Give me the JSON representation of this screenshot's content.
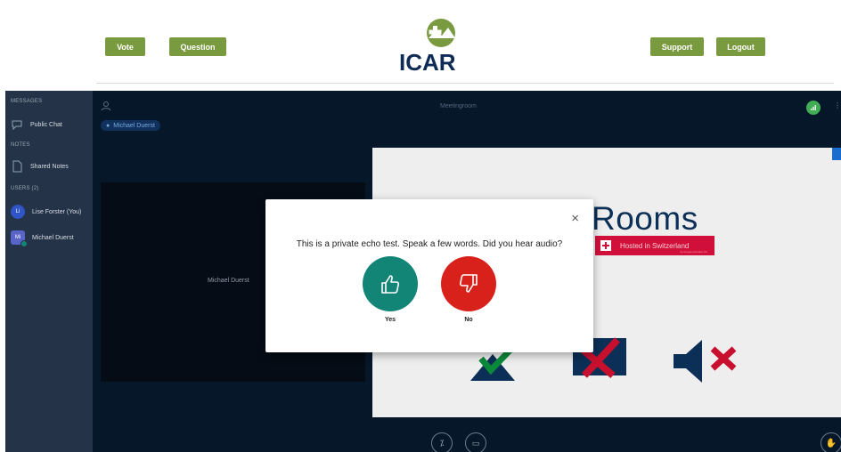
{
  "header": {
    "vote_label": "Vote",
    "question_label": "Question",
    "support_label": "Support",
    "logout_label": "Logout",
    "logo_text": "ICAR",
    "accent": "#7a9a3f"
  },
  "sidebar": {
    "messages_heading": "MESSAGES",
    "public_chat": "Public Chat",
    "notes_heading": "NOTES",
    "shared_notes": "Shared Notes",
    "users_heading": "USERS (2)",
    "users": [
      {
        "initials": "Li",
        "name": "Lise Forster (You)",
        "color": "#2f55c6"
      },
      {
        "initials": "Mi",
        "name": "Michael Duerst",
        "color": "#5a64c8"
      }
    ]
  },
  "main": {
    "title": "Meetingroom",
    "presenter_chip": "Michael Duerst",
    "camera_name": "Michael Duerst",
    "slide_title": "Rooms",
    "slide_hosted": "Hosted in Switzerland",
    "slide_hosted_sub": "by bringa-Lebruder AG"
  },
  "modal": {
    "message": "This is a private echo test. Speak a few words. Did you hear audio?",
    "yes_label": "Yes",
    "no_label": "No",
    "yes_color": "#138577",
    "no_color": "#d9211b"
  }
}
